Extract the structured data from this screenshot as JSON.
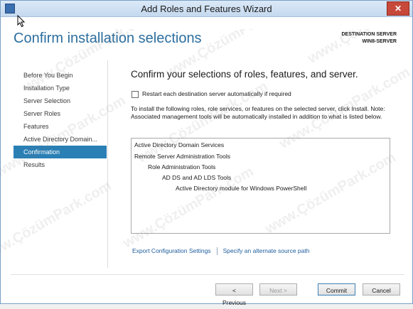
{
  "window": {
    "title": "Add Roles and Features Wizard",
    "close_label": "✕"
  },
  "header": {
    "title": "Confirm installation selections",
    "destination_label": "DESTINATION SERVER",
    "destination_server": "WIN8-SERVER"
  },
  "sidebar": {
    "items": [
      {
        "label": "Before You Begin",
        "active": false
      },
      {
        "label": "Installation Type",
        "active": false
      },
      {
        "label": "Server Selection",
        "active": false
      },
      {
        "label": "Server Roles",
        "active": false
      },
      {
        "label": "Features",
        "active": false
      },
      {
        "label": "Active Directory Domain...",
        "active": false
      },
      {
        "label": "Confirmation",
        "active": true
      },
      {
        "label": "Results",
        "active": false
      }
    ]
  },
  "main": {
    "heading": "Confirm your selections of roles, features, and server.",
    "restart_checkbox": {
      "label": "Restart each destination server automatically if required",
      "checked": false
    },
    "info_text": "To install the following roles, role services, or features on the selected server, click Install. Note: Associated management tools will be automatically installed in addition to what is listed below.",
    "selections": [
      {
        "text": "Active Directory Domain Services",
        "level": 0
      },
      {
        "text": "Remote Server Administration Tools",
        "level": 0
      },
      {
        "text": "Role Administration Tools",
        "level": 1
      },
      {
        "text": "AD DS and AD LDS Tools",
        "level": 2
      },
      {
        "text": "Active Directory module for Windows PowerShell",
        "level": 3
      }
    ],
    "export_link": "Export Configuration Settings",
    "alternate_source_link": "Specify an alternate source path"
  },
  "footer": {
    "previous_label": "< Previous",
    "next_label": "Next >",
    "commit_label": "Commit",
    "cancel_label": "Cancel"
  },
  "watermark": {
    "text": "www.ÇözümPark.com"
  }
}
